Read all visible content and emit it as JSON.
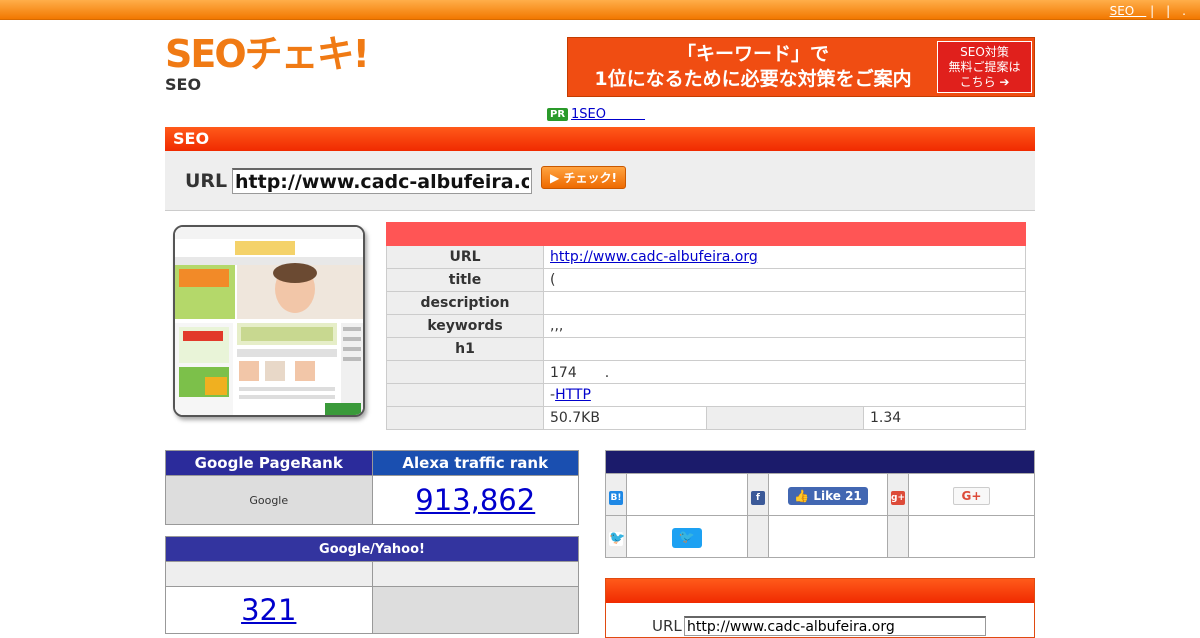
{
  "topbar": {
    "link1": "SEO　",
    "sep": "|　|　."
  },
  "logo": {
    "text": "SEOチェキ!",
    "sub": "SEO"
  },
  "banner": {
    "text1": "「キーワード」で",
    "text2": "1位になるために必要な対策をご案内",
    "button": "SEO対策\n無料ご提案は\nこちら ➔"
  },
  "pr": {
    "badge": "PR",
    "link": "1SEO　　　"
  },
  "section": {
    "title": "SEO",
    "url_label": "URL",
    "url_value": "http://www.cadc-albufeira.org",
    "check_label": "▶ チェック!"
  },
  "info": {
    "rows": [
      {
        "label": "URL",
        "value": "http://www.cadc-albufeira.org",
        "link": true
      },
      {
        "label": "title",
        "value": "("
      },
      {
        "label": "description",
        "value": ""
      },
      {
        "label": "keywords",
        "value": ",,,"
      },
      {
        "label": "h1",
        "value": ""
      },
      {
        "label": "",
        "value": "174　　."
      },
      {
        "label": "",
        "value_prefix": "-",
        "value_link": "HTTP"
      }
    ],
    "size_value": "50.7KB",
    "time_value": "1.34"
  },
  "rank": {
    "pagerank_label": "Google PageRank",
    "alexa_label": "Alexa traffic rank",
    "pagerank_value": "Google",
    "alexa_value": "913,862"
  },
  "gy": {
    "title": "Google/Yahoo!",
    "value": "321"
  },
  "social": {
    "like_label": "Like",
    "like_count": "21",
    "gplus_label": "G+"
  },
  "lower": {
    "url_label": "URL",
    "url_value": "http://www.cadc-albufeira.org"
  },
  "colors": {
    "accent": "#f27800",
    "header_red": "#f02a00",
    "navy": "#1b1b6b"
  }
}
